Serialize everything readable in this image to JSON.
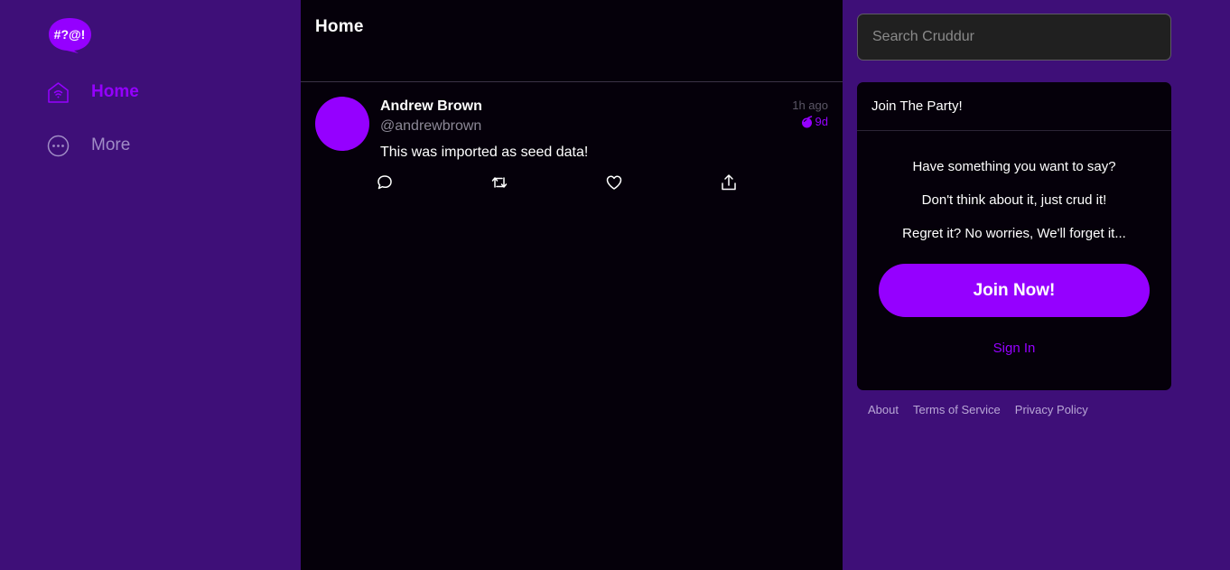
{
  "sidebar": {
    "logo_text": "#?@!",
    "items": [
      {
        "label": "Home",
        "icon": "home-icon"
      },
      {
        "label": "More",
        "icon": "more-icon"
      }
    ]
  },
  "main": {
    "title": "Home",
    "activity": {
      "display_name": "Andrew Brown",
      "handle": "@andrewbrown",
      "message": "This was imported as seed data!",
      "time_ago": "1h ago",
      "expires": "9d"
    }
  },
  "right": {
    "search": {
      "placeholder": "Search Cruddur"
    },
    "join": {
      "title": "Join The Party!",
      "lines": [
        "Have something you want to say?",
        "Don't think about it, just crud it!",
        "Regret it? No worries, We'll forget it..."
      ],
      "join_label": "Join Now!",
      "signin_label": "Sign In"
    },
    "footer": [
      "About",
      "Terms of Service",
      "Privacy Policy"
    ]
  },
  "colors": {
    "accent": "#9500ff",
    "background": "#3e0f78",
    "panel": "#05000a"
  }
}
